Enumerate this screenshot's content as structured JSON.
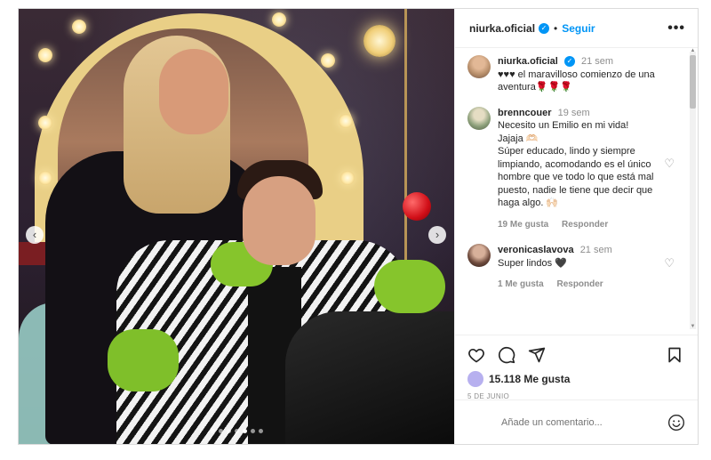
{
  "post": {
    "author": "niurka.oficial",
    "follow_label": "Seguir",
    "more_label": "•••",
    "separator": "•",
    "verified_mark": "✓",
    "caption_author": "niurka.oficial",
    "caption_time": "21 sem",
    "caption_text": "♥♥♥ el maravilloso comienzo de una aventura🌹🌹🌹"
  },
  "media": {
    "prev_label": "‹",
    "next_label": "›",
    "dots_total": 7,
    "dot_active_index": 4
  },
  "comments": [
    {
      "user": "brenncouer",
      "time": "19 sem",
      "lines": [
        "Necesito un Emilio en mi vida!",
        "Jajaja 🫶🏻",
        "Súper educado, lindo y siempre limpiando, acomodando es el único hombre que ve todo lo que está mal puesto, nadie le tiene que decir que haga algo. 🙌🏻"
      ],
      "likes": "19 Me gusta",
      "reply": "Responder"
    },
    {
      "user": "veronicaslavova",
      "time": "21 sem",
      "lines": [
        "Super lindos 🖤"
      ],
      "likes": "1 Me gusta",
      "reply": "Responder"
    }
  ],
  "engagement": {
    "likes_avatar_text": "",
    "likes": "15.118 Me gusta",
    "date": "5 DE JUNIO"
  },
  "composer": {
    "placeholder": "Añade un comentario..."
  },
  "icons": {
    "like": "heart-icon",
    "comment": "comment-icon",
    "share": "share-icon",
    "save": "bookmark-icon",
    "emoji": "emoji-icon"
  },
  "colors": {
    "accent": "#0095f6",
    "text": "#262626",
    "muted": "#8e8e8e"
  }
}
